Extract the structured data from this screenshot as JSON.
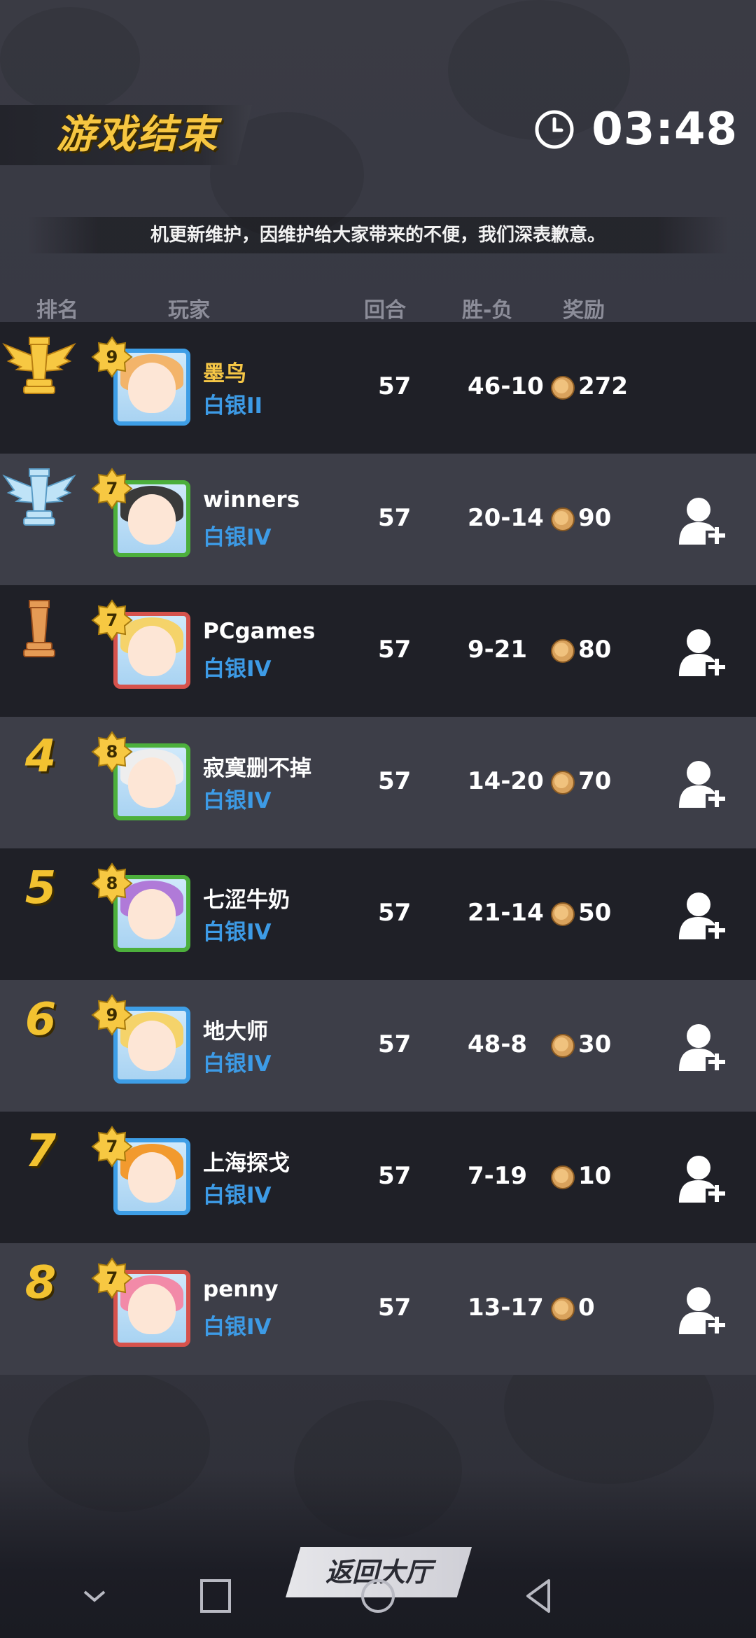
{
  "header": {
    "title": "游戏结束",
    "timer": "03:48"
  },
  "notice": "机更新维护，因维护给大家带来的不便，我们深表歉意。",
  "columns": {
    "rank": "排名",
    "player": "玩家",
    "rounds": "回合",
    "record": "胜-负",
    "reward": "奖励"
  },
  "players": [
    {
      "rank": "",
      "trophy": "gold",
      "level": "9",
      "name": "墨鸟",
      "tier": "白银II",
      "rounds": "57",
      "record": "46-10",
      "reward": "272",
      "add_friend": false
    },
    {
      "rank": "",
      "trophy": "silver",
      "level": "7",
      "name": "winners",
      "tier": "白银IV",
      "rounds": "57",
      "record": "20-14",
      "reward": "90",
      "add_friend": true
    },
    {
      "rank": "",
      "trophy": "bronze",
      "level": "7",
      "name": "PCgames",
      "tier": "白银IV",
      "rounds": "57",
      "record": "9-21",
      "reward": "80",
      "add_friend": true
    },
    {
      "rank": "4",
      "level": "8",
      "name": "寂寞删不掉",
      "tier": "白银IV",
      "rounds": "57",
      "record": "14-20",
      "reward": "70",
      "add_friend": true
    },
    {
      "rank": "5",
      "level": "8",
      "name": "七涩牛奶",
      "tier": "白银IV",
      "rounds": "57",
      "record": "21-14",
      "reward": "50",
      "add_friend": true
    },
    {
      "rank": "6",
      "level": "9",
      "name": "地大师",
      "tier": "白银IV",
      "rounds": "57",
      "record": "48-8",
      "reward": "30",
      "add_friend": true
    },
    {
      "rank": "7",
      "level": "7",
      "name": "上海探戈",
      "tier": "白银IV",
      "rounds": "57",
      "record": "7-19",
      "reward": "10",
      "add_friend": true
    },
    {
      "rank": "8",
      "level": "7",
      "name": "penny",
      "tier": "白银IV",
      "rounds": "57",
      "record": "13-17",
      "reward": "0",
      "add_friend": true
    }
  ],
  "footer": {
    "back_label": "返回大厅"
  },
  "nav_icons": [
    "chevron-down-icon",
    "square-icon",
    "circle-icon",
    "triangle-back-icon"
  ]
}
